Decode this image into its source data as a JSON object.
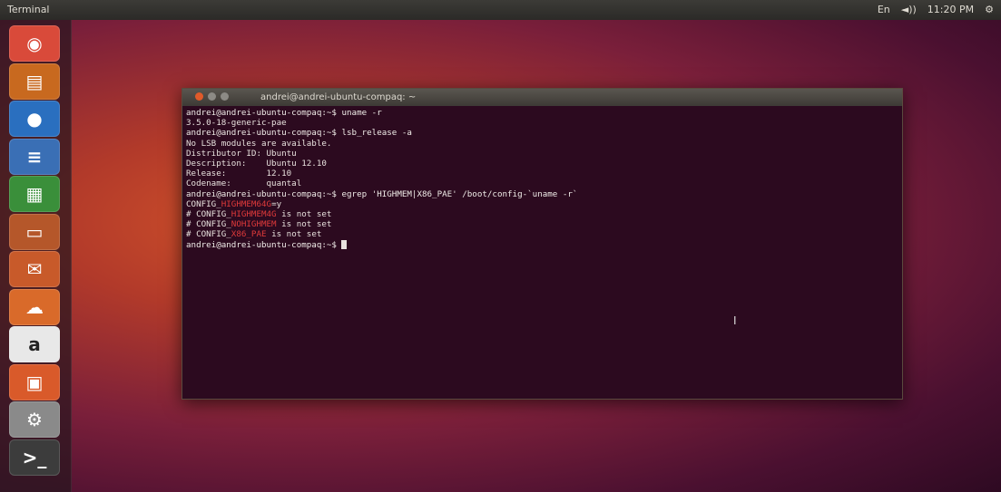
{
  "top_panel": {
    "app_title": "Terminal",
    "indicators": [
      "En",
      "◄))",
      "11:20 PM",
      "⚙"
    ]
  },
  "launcher": {
    "items": [
      {
        "name": "dash-home",
        "glyph": "◉",
        "color": "#d94a3a"
      },
      {
        "name": "files",
        "glyph": "▤",
        "color": "#c8691f"
      },
      {
        "name": "firefox",
        "glyph": "●",
        "color": "#2a6fbf"
      },
      {
        "name": "writer",
        "glyph": "≡",
        "color": "#3a6fb5"
      },
      {
        "name": "calc",
        "glyph": "▦",
        "color": "#3a8f3a"
      },
      {
        "name": "impress",
        "glyph": "▭",
        "color": "#b5572a"
      },
      {
        "name": "software-center",
        "glyph": "✉",
        "color": "#c85a2a"
      },
      {
        "name": "ubuntu-one",
        "glyph": "☁",
        "color": "#d96a2a"
      },
      {
        "name": "amazon",
        "glyph": "a",
        "color": "#e8e8e8"
      },
      {
        "name": "app-store",
        "glyph": "▣",
        "color": "#d95a2a"
      },
      {
        "name": "settings",
        "glyph": "⚙",
        "color": "#8a8a8a"
      },
      {
        "name": "terminal",
        "glyph": ">_",
        "color": "#3c3c3c"
      }
    ]
  },
  "terminal": {
    "title": "andrei@andrei-ubuntu-compaq: ~",
    "lines": [
      {
        "parts": [
          {
            "t": "andrei@andrei-ubuntu-compaq:~$ uname -r",
            "c": "prompt"
          }
        ]
      },
      {
        "parts": [
          {
            "t": "3.5.0-18-generic-pae",
            "c": ""
          }
        ]
      },
      {
        "parts": [
          {
            "t": "andrei@andrei-ubuntu-compaq:~$ lsb_release -a",
            "c": "prompt"
          }
        ]
      },
      {
        "parts": [
          {
            "t": "No LSB modules are available.",
            "c": ""
          }
        ]
      },
      {
        "parts": [
          {
            "t": "Distributor ID: Ubuntu",
            "c": ""
          }
        ]
      },
      {
        "parts": [
          {
            "t": "Description:    Ubuntu 12.10",
            "c": ""
          }
        ]
      },
      {
        "parts": [
          {
            "t": "Release:        12.10",
            "c": ""
          }
        ]
      },
      {
        "parts": [
          {
            "t": "Codename:       quantal",
            "c": ""
          }
        ]
      },
      {
        "parts": [
          {
            "t": "andrei@andrei-ubuntu-compaq:~$ egrep 'HIGHMEM|X86_PAE' /boot/config-`uname -r`",
            "c": "prompt"
          }
        ]
      },
      {
        "parts": [
          {
            "t": "CONFIG_",
            "c": ""
          },
          {
            "t": "HIGHMEM64G",
            "c": "red"
          },
          {
            "t": "=y",
            "c": ""
          }
        ]
      },
      {
        "parts": [
          {
            "t": "# CONFIG_",
            "c": ""
          },
          {
            "t": "HIGHMEM4G",
            "c": "red"
          },
          {
            "t": " is not set",
            "c": ""
          }
        ]
      },
      {
        "parts": [
          {
            "t": "# CONFIG_",
            "c": ""
          },
          {
            "t": "NOHIGHMEM",
            "c": "red"
          },
          {
            "t": " is not set",
            "c": ""
          }
        ]
      },
      {
        "parts": [
          {
            "t": "# CONFIG_",
            "c": ""
          },
          {
            "t": "X86_PAE",
            "c": "red"
          },
          {
            "t": " is not set",
            "c": ""
          }
        ]
      },
      {
        "parts": [
          {
            "t": "andrei@andrei-ubuntu-compaq:~$ ",
            "c": "prompt"
          }
        ],
        "cursor": true
      }
    ]
  }
}
